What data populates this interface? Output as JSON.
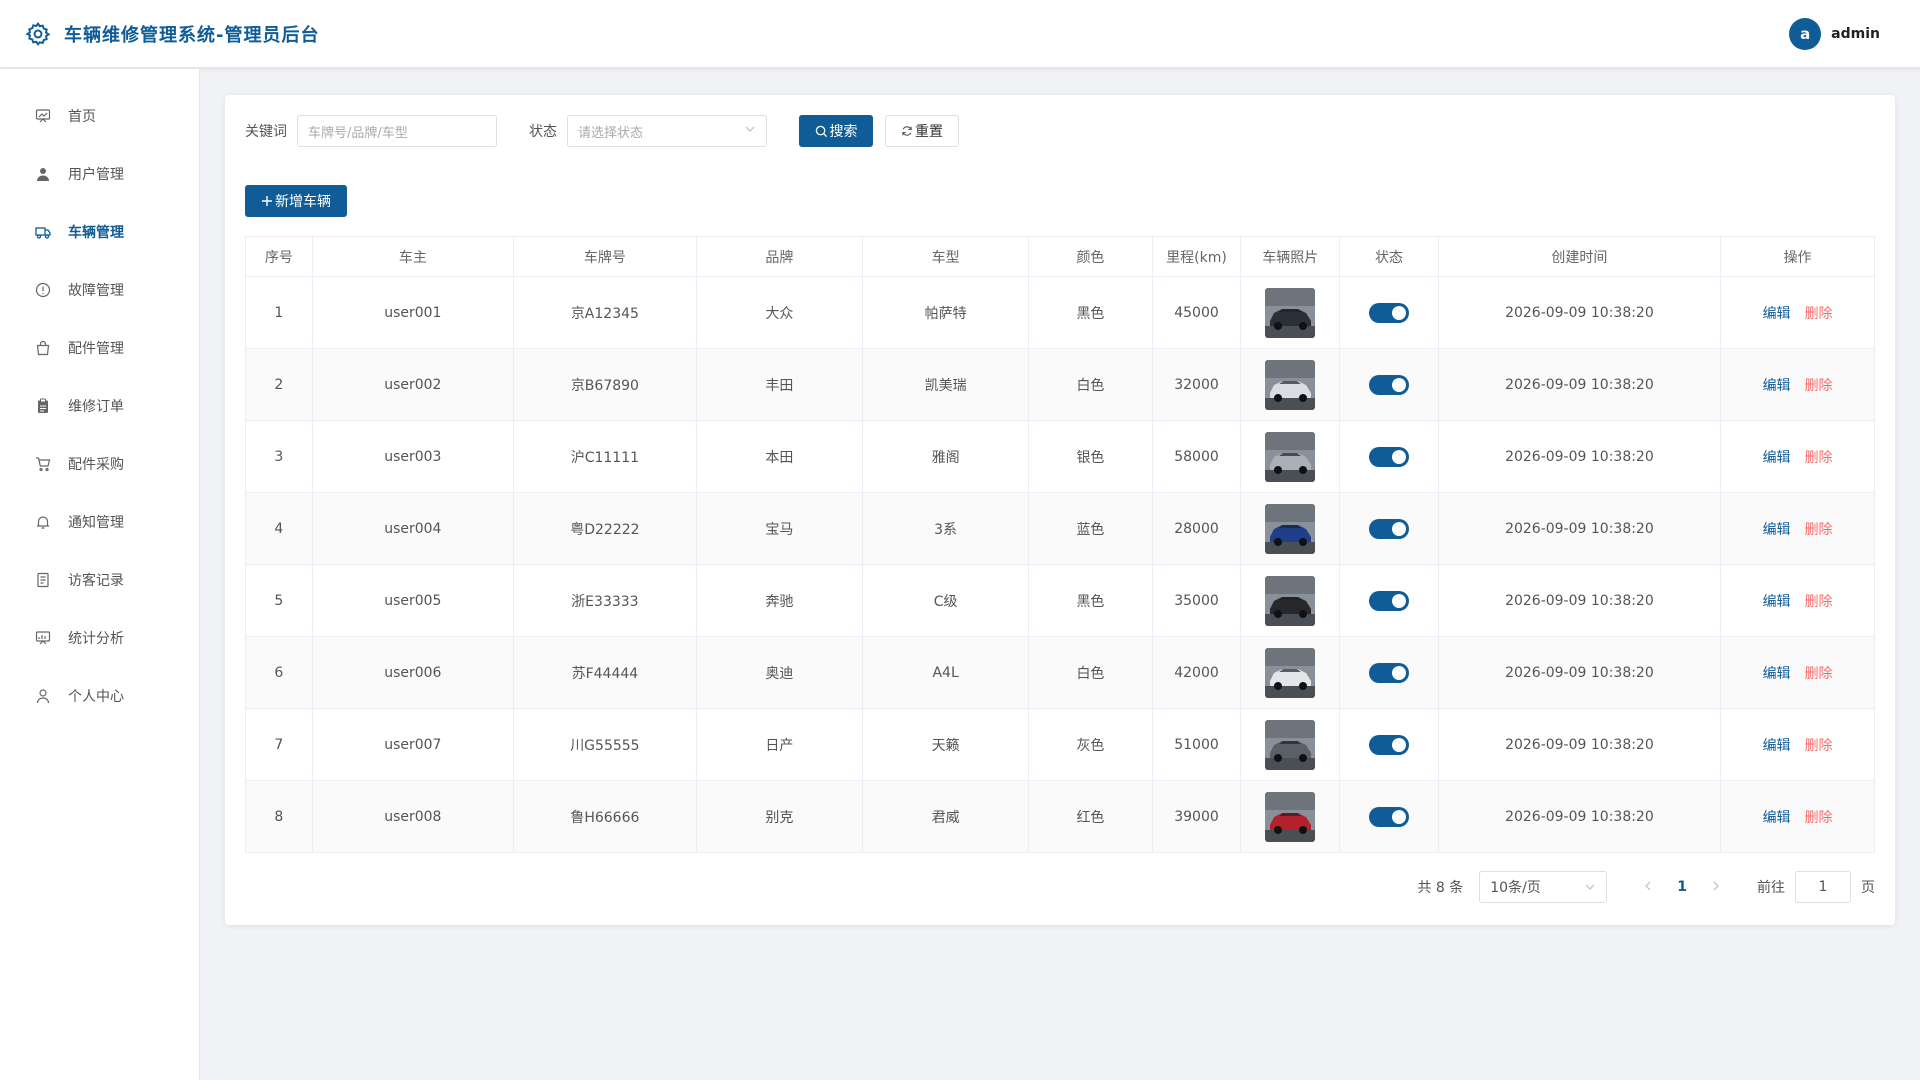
{
  "app": {
    "title": "车辆维修管理系统-管理员后台"
  },
  "user": {
    "avatar_letter": "a",
    "name": "admin"
  },
  "sidebar": {
    "items": [
      {
        "label": "首页",
        "icon": "dashboard-icon"
      },
      {
        "label": "用户管理",
        "icon": "user-icon"
      },
      {
        "label": "车辆管理",
        "icon": "truck-icon",
        "active": true
      },
      {
        "label": "故障管理",
        "icon": "warning-circle-icon"
      },
      {
        "label": "配件管理",
        "icon": "bag-icon"
      },
      {
        "label": "维修订单",
        "icon": "clipboard-icon"
      },
      {
        "label": "配件采购",
        "icon": "cart-icon"
      },
      {
        "label": "通知管理",
        "icon": "bell-icon"
      },
      {
        "label": "访客记录",
        "icon": "document-icon"
      },
      {
        "label": "统计分析",
        "icon": "chart-board-icon"
      },
      {
        "label": "个人中心",
        "icon": "person-icon"
      }
    ]
  },
  "search": {
    "keyword_label": "关键词",
    "keyword_placeholder": "车牌号/品牌/车型",
    "status_label": "状态",
    "status_placeholder": "请选择状态",
    "search_button": "搜索",
    "reset_button": "重置"
  },
  "add_button": "新增车辆",
  "table": {
    "headers": [
      "序号",
      "车主",
      "车牌号",
      "品牌",
      "车型",
      "颜色",
      "里程(km)",
      "车辆照片",
      "状态",
      "创建时间",
      "操作"
    ],
    "edit_label": "编辑",
    "delete_label": "删除",
    "rows": [
      {
        "no": "1",
        "owner": "user001",
        "plate": "京A12345",
        "brand": "大众",
        "model": "帕萨特",
        "color": "黑色",
        "mileage": "45000",
        "photo_color": "#2b2f36",
        "status": true,
        "created": "2026-09-09 10:38:20"
      },
      {
        "no": "2",
        "owner": "user002",
        "plate": "京B67890",
        "brand": "丰田",
        "model": "凯美瑞",
        "color": "白色",
        "mileage": "32000",
        "photo_color": "#d9dde2",
        "status": true,
        "created": "2026-09-09 10:38:20"
      },
      {
        "no": "3",
        "owner": "user003",
        "plate": "沪C11111",
        "brand": "本田",
        "model": "雅阁",
        "color": "银色",
        "mileage": "58000",
        "photo_color": "#aab0b7",
        "status": true,
        "created": "2026-09-09 10:38:20"
      },
      {
        "no": "4",
        "owner": "user004",
        "plate": "粤D22222",
        "brand": "宝马",
        "model": "3系",
        "color": "蓝色",
        "mileage": "28000",
        "photo_color": "#1f3f8a",
        "status": true,
        "created": "2026-09-09 10:38:20"
      },
      {
        "no": "5",
        "owner": "user005",
        "plate": "浙E33333",
        "brand": "奔驰",
        "model": "C级",
        "color": "黑色",
        "mileage": "35000",
        "photo_color": "#26282c",
        "status": true,
        "created": "2026-09-09 10:38:20"
      },
      {
        "no": "6",
        "owner": "user006",
        "plate": "苏F44444",
        "brand": "奥迪",
        "model": "A4L",
        "color": "白色",
        "mileage": "42000",
        "photo_color": "#e3e5e8",
        "status": true,
        "created": "2026-09-09 10:38:20"
      },
      {
        "no": "7",
        "owner": "user007",
        "plate": "川G55555",
        "brand": "日产",
        "model": "天籁",
        "color": "灰色",
        "mileage": "51000",
        "photo_color": "#5b6068",
        "status": true,
        "created": "2026-09-09 10:38:20"
      },
      {
        "no": "8",
        "owner": "user008",
        "plate": "鲁H66666",
        "brand": "别克",
        "model": "君威",
        "color": "红色",
        "mileage": "39000",
        "photo_color": "#b3222c",
        "status": true,
        "created": "2026-09-09 10:38:20"
      }
    ]
  },
  "pagination": {
    "total_text": "共 8 条",
    "page_size": "10条/页",
    "current_page": "1",
    "goto_label": "前往",
    "goto_value": "1",
    "page_suffix": "页"
  },
  "colors": {
    "primary": "#0f5c96",
    "danger": "#f56c6c"
  }
}
